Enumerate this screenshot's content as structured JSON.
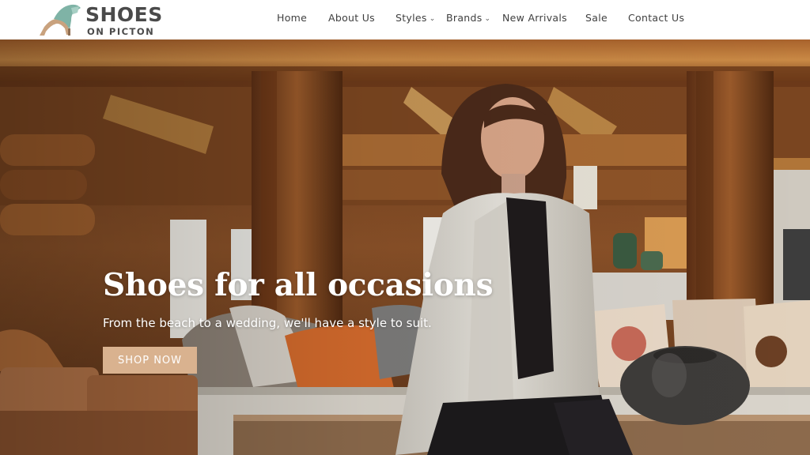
{
  "brand": {
    "name_line1": "SHOES",
    "name_line2": "ON PICTON",
    "logo_icon": "high-heel-shoe-icon"
  },
  "nav": {
    "items": [
      {
        "label": "Home"
      },
      {
        "label": "About Us"
      },
      {
        "label": "Styles",
        "dropdown": true
      },
      {
        "label": "Brands",
        "dropdown": true
      },
      {
        "label": "New Arrivals"
      },
      {
        "label": "Sale"
      },
      {
        "label": "Contact Us"
      }
    ],
    "caret": "⌄"
  },
  "hero": {
    "title": "Shoes for all occasions",
    "subtitle": "From the beach to a wedding, we'll have a style to suit.",
    "cta_label": "SHOP NOW"
  },
  "colors": {
    "cta_background": "#d9b28f",
    "nav_text": "#3f3f3f",
    "logo_text": "#4a4a4a",
    "logo_teal": "#7fb3a6",
    "logo_tan": "#c9a27e"
  }
}
